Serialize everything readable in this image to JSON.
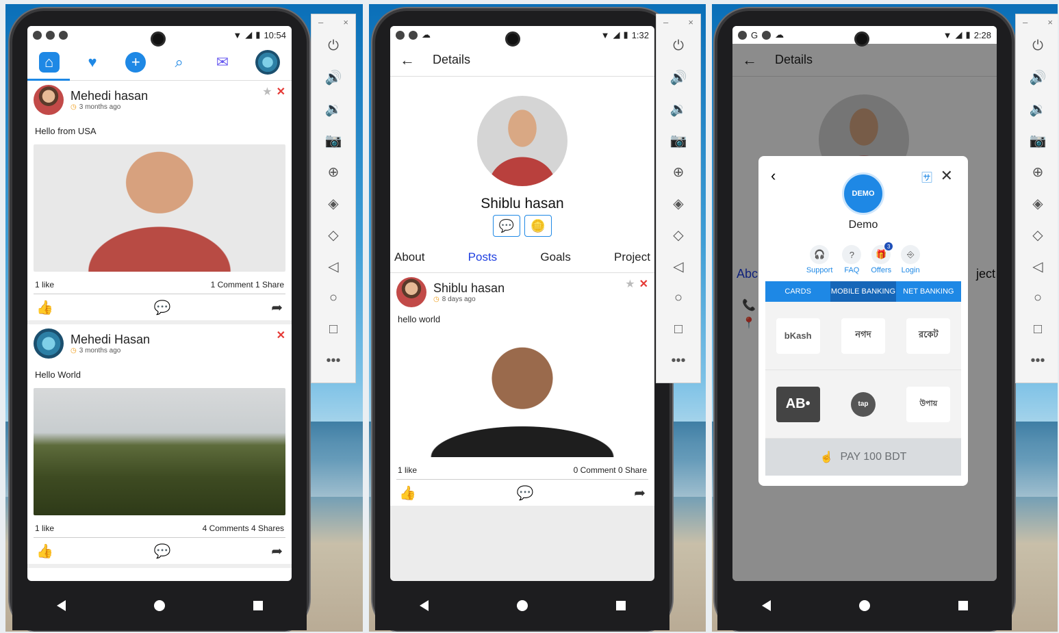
{
  "emulator": {
    "minimize": "–",
    "close": "×"
  },
  "screen1": {
    "status_time": "10:54",
    "posts": [
      {
        "author": "Mehedi hasan",
        "time": "3 months ago",
        "text": "Hello from USA",
        "likes": "1 like",
        "comments": "1 Comment",
        "shares": "1 Share"
      },
      {
        "author": "Mehedi Hasan",
        "time": "3 months ago",
        "text": "Hello World",
        "likes": "1 like",
        "comments": "4 Comments",
        "shares": "4 Shares"
      }
    ]
  },
  "screen2": {
    "status_time": "1:32",
    "header_title": "Details",
    "profile_name": "Shiblu hasan",
    "tabs": [
      "About",
      "Posts",
      "Goals",
      "Project"
    ],
    "active_tab": "Posts",
    "post": {
      "author": "Shiblu hasan",
      "time": "8 days ago",
      "text": "hello world",
      "likes": "1 like",
      "comments": "0 Comment",
      "shares": "0 Share"
    }
  },
  "screen3": {
    "status_time": "2:28",
    "header_title": "Details",
    "bg_tab_left": "Abc",
    "bg_tab_right": "ject",
    "dialog": {
      "merchant": "Demo",
      "logo_text": "DEMO",
      "quick_links": [
        "Support",
        "FAQ",
        "Offers",
        "Login"
      ],
      "offers_badge": "3",
      "pay_tabs": [
        "CARDS",
        "MOBILE BANKING",
        "NET BANKING"
      ],
      "active_pay_tab": "MOBILE BANKING",
      "methods": [
        "bKash",
        "নগদ",
        "রকেট",
        "AB•",
        "tap",
        "উপায়"
      ],
      "pay_button": "PAY 100 BDT"
    }
  }
}
